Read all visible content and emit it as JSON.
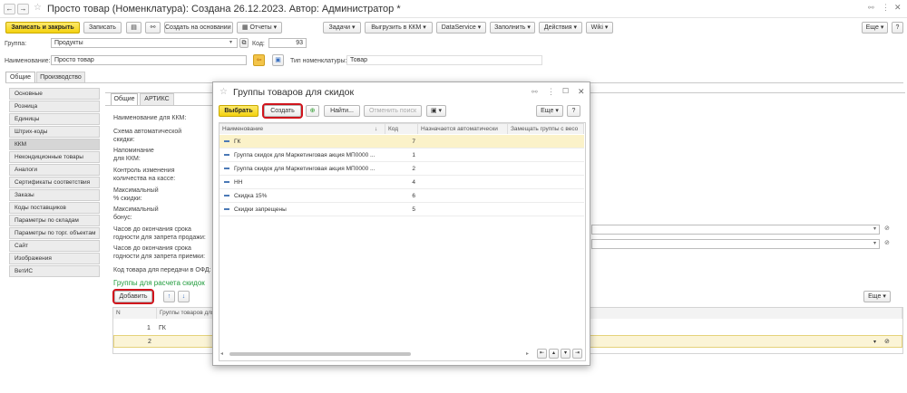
{
  "window": {
    "title": "Просто товар (Номенклатура): Создана 26.12.2023. Автор: Администратор *"
  },
  "toolbar": {
    "save_close": "Записать и закрыть",
    "save": "Записать",
    "create_based": "Создать на основании",
    "reports": "Отчеты",
    "tasks": "Задачи",
    "upload_kkm": "Выгрузить в ККМ",
    "dataservice": "DataService",
    "fill": "Заполнить",
    "actions": "Действия",
    "wiki": "Wiki",
    "more": "Еще",
    "help": "?"
  },
  "header": {
    "group_label": "Группа:",
    "group_value": "Продукты",
    "code_label": "Код:",
    "code_value": "93",
    "name_label": "Наименование:",
    "name_value": "Просто товар",
    "type_label": "Тип номенклатуры:",
    "type_value": "Товар"
  },
  "tabs": {
    "general": "Общие",
    "production": "Производство"
  },
  "sidebar": {
    "items": [
      "Основные",
      "Розница",
      "Единицы",
      "Штрих-коды",
      "ККМ",
      "Некондиционные товары",
      "Аналоги",
      "Сертификаты соответствия",
      "Заказы",
      "Коды поставщиков",
      "Параметры по складам",
      "Параметры по торг. объектам",
      "Сайт",
      "Изображения",
      "ВетИС"
    ]
  },
  "inner_tabs": {
    "general": "Общие",
    "artiks": "АРТИКС"
  },
  "form": {
    "kkm_name": "Наименование для ККМ:",
    "auto_discount_1": "Схема автоматической",
    "auto_discount_2": "скидки:",
    "reminder_1": "Напоминание",
    "reminder_2": "для ККМ:",
    "qty_control_1": "Контроль изменения",
    "qty_control_2": "количества на кассе:",
    "max_discount_1": "Максимальный",
    "max_discount_2": "% скидки:",
    "max_bonus_1": "Максимальный",
    "max_bonus_2": "бонус:",
    "hours_sale_1": "Часов до окончания срока",
    "hours_sale_2": "годности для запрета продажи:",
    "hours_recv_1": "Часов до окончания срока",
    "hours_recv_2": "годности для запрета приемки:",
    "ofd_code": "Код товара для передачи в ОФД:",
    "groups_link": "Группы для расчета скидок",
    "add": "Добавить",
    "more": "Еще",
    "col_n": "N",
    "col_group": "Группы товаров для",
    "rows": [
      {
        "n": "1",
        "name": "ГК"
      },
      {
        "n": "2",
        "name": ""
      }
    ]
  },
  "dialog": {
    "title": "Группы товаров для скидок",
    "choose": "Выбрать",
    "create": "Создать",
    "find": "Найти...",
    "cancel_search": "Отменить поиск",
    "more": "Еще",
    "help": "?",
    "columns": {
      "name": "Наименование",
      "code": "Код",
      "auto": "Назначается автоматически",
      "replace": "Замещать группы с весо"
    },
    "rows": [
      {
        "name": "ГК",
        "code": "7"
      },
      {
        "name": "Группа скидок для Маркетинговая акция МП0000 ...",
        "code": "1"
      },
      {
        "name": "Группа скидок для Маркетинговая акция МП0000 ...",
        "code": "2"
      },
      {
        "name": "НН",
        "code": "4"
      },
      {
        "name": "Скидка 15%",
        "code": "6"
      },
      {
        "name": "Скидки запрещены",
        "code": "5"
      }
    ]
  }
}
